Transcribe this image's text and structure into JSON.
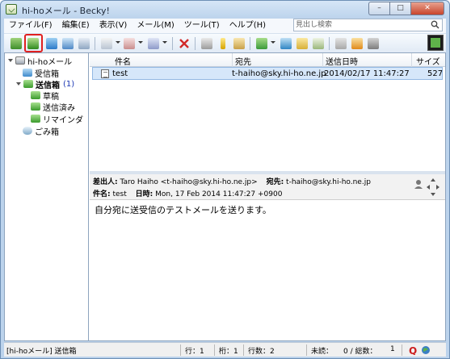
{
  "window": {
    "title": "hi-hoメール - Becky!"
  },
  "menu": {
    "items": [
      "ファイル(F)",
      "編集(E)",
      "表示(V)",
      "メール(M)",
      "ツール(T)",
      "ヘルプ(H)"
    ],
    "search_placeholder": "見出し検索"
  },
  "toolbar": {
    "buttons": [
      "receive-icon",
      "receive-all-icon",
      "send-icon",
      "send-receive-icon",
      "address-book-icon",
      "new-mail-icon",
      "reply-icon",
      "forward-icon",
      "delete-icon",
      "filter-icon",
      "pen-icon",
      "template-icon",
      "folder-move-icon",
      "attachment-icon",
      "clipboard-icon",
      "edit-icon",
      "print-icon",
      "options-icon",
      "plugin-icon"
    ],
    "highlighted": "receive-all-icon"
  },
  "folders": {
    "account": "hi-hoメール",
    "items": [
      {
        "label": "受信箱",
        "bold": false,
        "count": ""
      },
      {
        "label": "送信箱",
        "bold": true,
        "count": "(1)"
      },
      {
        "label": "草稿",
        "bold": false,
        "count": ""
      },
      {
        "label": "送信済み",
        "bold": false,
        "count": ""
      },
      {
        "label": "リマインダ",
        "bold": false,
        "count": ""
      },
      {
        "label": "ごみ箱",
        "bold": false,
        "count": ""
      }
    ]
  },
  "list": {
    "columns": [
      "件名",
      "宛先",
      "送信日時",
      "サイズ"
    ],
    "rows": [
      {
        "subject": "test",
        "to": "t-haiho@sky.hi-ho.ne.jp",
        "date": "2014/02/17 11:47:27",
        "size": "527"
      }
    ]
  },
  "preview": {
    "from_label": "差出人:",
    "from_value": "Taro Haiho <t-haiho@sky.hi-ho.ne.jp>",
    "to_label": "宛先:",
    "to_value": "t-haiho@sky.hi-ho.ne.jp",
    "subject_label": "件名:",
    "subject_value": "test",
    "date_label": "日時:",
    "date_value": "Mon, 17 Feb 2014 11:47:27 +0900",
    "body": "自分宛に送受信のテストメールを送ります。"
  },
  "status": {
    "folder": "[hi-hoメール] 送信箱",
    "line": "行：1",
    "col": "桁：1",
    "lines": "行数：2",
    "unread": "未読：",
    "counts": "0 / 総数：",
    "total": "1"
  },
  "colors": {
    "accent": "#1a36b4",
    "highlight": "#e02020",
    "selection": "#d6e7fa"
  }
}
